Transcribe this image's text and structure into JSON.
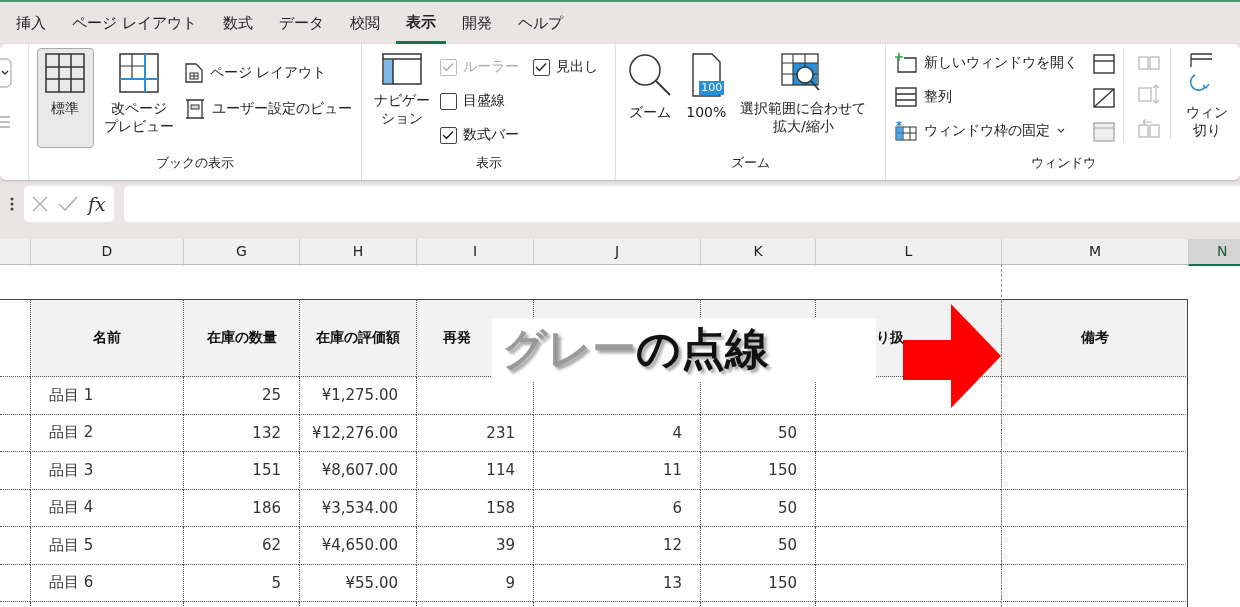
{
  "tabs": [
    {
      "label": "挿入",
      "selected": false
    },
    {
      "label": "ページ レイアウト",
      "selected": false
    },
    {
      "label": "数式",
      "selected": false
    },
    {
      "label": "データ",
      "selected": false
    },
    {
      "label": "校閲",
      "selected": false
    },
    {
      "label": "表示",
      "selected": true
    },
    {
      "label": "開発",
      "selected": false
    },
    {
      "label": "ヘルプ",
      "selected": false
    }
  ],
  "ribbon": {
    "book_view": {
      "label": "ブックの表示",
      "normal": {
        "label": "標準",
        "selected": true
      },
      "page_break": {
        "lines": [
          "改ページ",
          "プレビュー"
        ],
        "selected": false
      },
      "page_layout": "ページ レイアウト",
      "custom_views": "ユーザー設定のビュー"
    },
    "show": {
      "label": "表示",
      "navigation": [
        "ナビゲー",
        "ション"
      ],
      "checkboxes": [
        {
          "label": "ルーラー",
          "checked": true,
          "disabled": true
        },
        {
          "label": "目盛線",
          "checked": false,
          "disabled": false
        },
        {
          "label": "数式バー",
          "checked": true,
          "disabled": false
        },
        {
          "label": "見出し",
          "checked": true,
          "disabled": false
        }
      ]
    },
    "zoom": {
      "label": "ズーム",
      "zoom": "ズーム",
      "hundred": "100%",
      "hundred_icon": "100",
      "fit": [
        "選択範囲に合わせて",
        "拡大/縮小"
      ]
    },
    "window": {
      "label": "ウィンドウ",
      "new_window": "新しいウィンドウを開く",
      "arrange": "整列",
      "freeze": "ウィンドウ枠の固定",
      "switch": [
        "ウィン",
        "切り"
      ]
    }
  },
  "formula_bar": {
    "fx": "fx"
  },
  "columns": [
    {
      "letter": "D",
      "selected": false
    },
    {
      "letter": "G",
      "selected": false
    },
    {
      "letter": "H",
      "selected": false
    },
    {
      "letter": "I",
      "selected": false
    },
    {
      "letter": "J",
      "selected": false
    },
    {
      "letter": "K",
      "selected": false
    },
    {
      "letter": "L",
      "selected": false
    },
    {
      "letter": "M",
      "selected": false
    },
    {
      "letter": "N",
      "selected": true
    }
  ],
  "table": {
    "header": [
      {
        "text": "名前"
      },
      {
        "text": "在庫の数量"
      },
      {
        "text": "在庫の評価額"
      },
      {
        "text": "再発"
      },
      {
        "text": "り扱"
      },
      {
        "text": "備考"
      }
    ],
    "rows": [
      [
        {
          "text": "品目 1"
        },
        {
          "text": "25"
        },
        {
          "text": "¥1,275.00"
        },
        {},
        {},
        {},
        {},
        {}
      ],
      [
        {
          "text": "品目 2"
        },
        {
          "text": "132"
        },
        {
          "text": "¥12,276.00"
        },
        {
          "text": "231"
        },
        {
          "text": "4"
        },
        {
          "text": "50"
        },
        {},
        {}
      ],
      [
        {
          "text": "品目 3"
        },
        {
          "text": "151"
        },
        {
          "text": "¥8,607.00"
        },
        {
          "text": "114"
        },
        {
          "text": "11"
        },
        {
          "text": "150"
        },
        {},
        {}
      ],
      [
        {
          "text": "品目 4"
        },
        {
          "text": "186"
        },
        {
          "text": "¥3,534.00"
        },
        {
          "text": "158"
        },
        {
          "text": "6"
        },
        {
          "text": "50"
        },
        {},
        {}
      ],
      [
        {
          "text": "品目 5"
        },
        {
          "text": "62"
        },
        {
          "text": "¥4,650.00"
        },
        {
          "text": "39"
        },
        {
          "text": "12"
        },
        {
          "text": "50"
        },
        {},
        {}
      ],
      [
        {
          "text": "品目 6"
        },
        {
          "text": "5"
        },
        {
          "text": "¥55.00"
        },
        {
          "text": "9"
        },
        {
          "text": "13"
        },
        {
          "text": "150"
        },
        {},
        {}
      ]
    ]
  },
  "annotation": {
    "callout": [
      {
        "text": "グレー",
        "color": "#9a9a9a"
      },
      {
        "text": "の点線",
        "color": "#111111"
      }
    ]
  }
}
